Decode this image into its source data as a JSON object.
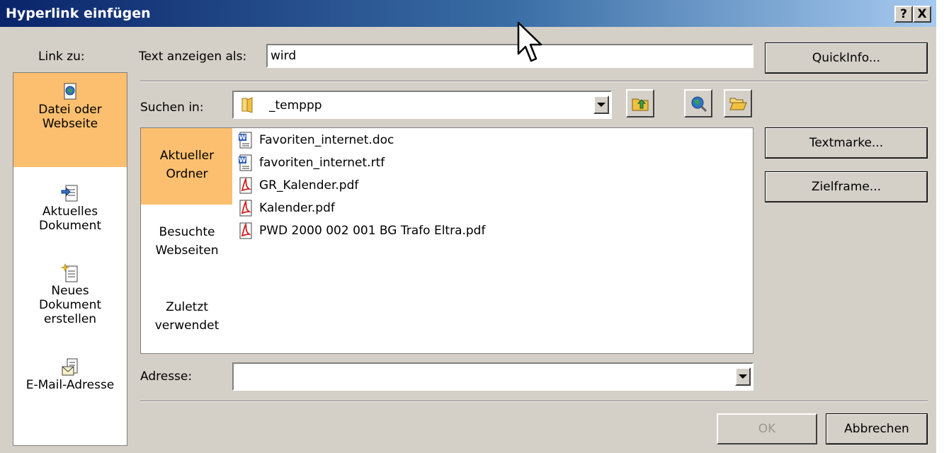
{
  "window": {
    "title": "Hyperlink einfügen",
    "help_button": "?",
    "close_button": "X"
  },
  "link_to": {
    "label": "Link zu:",
    "items": [
      {
        "line1": "Datei oder",
        "line2": "Webseite",
        "icon": "web-page-icon",
        "selected": true
      },
      {
        "line1": "Aktuelles",
        "line2": "Dokument",
        "icon": "current-document-icon",
        "selected": false
      },
      {
        "line1": "Neues",
        "line2": "Dokument",
        "line3": "erstellen",
        "icon": "new-document-icon",
        "selected": false
      },
      {
        "line1": "E-Mail-Adresse",
        "icon": "email-icon",
        "selected": false
      }
    ]
  },
  "display_text": {
    "label": "Text anzeigen als:",
    "value": "wird"
  },
  "search_in": {
    "label": "Suchen in:",
    "value": "_temppp",
    "icon": "folder-icon"
  },
  "nav": {
    "items": [
      {
        "line1": "Aktueller",
        "line2": "Ordner",
        "selected": true
      },
      {
        "line1": "Besuchte",
        "line2": "Webseiten",
        "selected": false
      },
      {
        "line1": "Zuletzt",
        "line2": "verwendet",
        "selected": false
      }
    ]
  },
  "files": [
    {
      "name": "Favoriten_internet.doc",
      "icon": "word-document-icon"
    },
    {
      "name": "favoriten_internet.rtf",
      "icon": "word-document-icon"
    },
    {
      "name": "GR_Kalender.pdf",
      "icon": "pdf-icon"
    },
    {
      "name": "Kalender.pdf",
      "icon": "pdf-icon"
    },
    {
      "name": "PWD 2000 002 001 BG Trafo Eltra.pdf",
      "icon": "pdf-icon"
    }
  ],
  "address": {
    "label": "Adresse:",
    "value": ""
  },
  "buttons": {
    "quickinfo": "QuickInfo...",
    "bookmark": "Textmarke...",
    "target_frame": "Zielframe...",
    "ok": "OK",
    "cancel": "Abbrechen"
  },
  "colors": {
    "selected": "#fbbf6f",
    "dialog_bg": "#d4d0c8",
    "title_start": "#0a246a",
    "title_end": "#a6caf0"
  }
}
